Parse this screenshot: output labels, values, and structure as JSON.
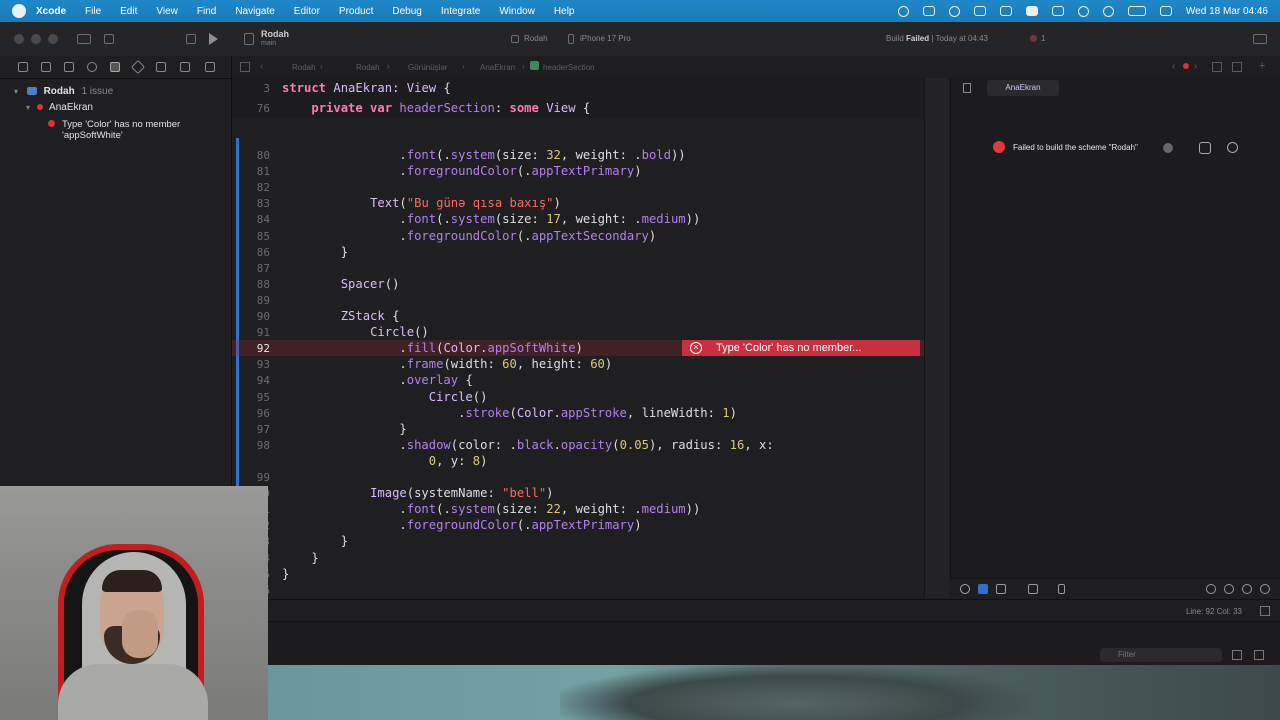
{
  "menubar": {
    "app": "Xcode",
    "items": [
      "File",
      "Edit",
      "View",
      "Find",
      "Navigate",
      "Editor",
      "Product",
      "Debug",
      "Integrate",
      "Window",
      "Help"
    ],
    "datetime": "Wed 18 Mar  04:46"
  },
  "toolbar": {
    "project": "Rodah",
    "branch": "main",
    "scheme": "Rodah",
    "device": "iPhone 17 Pro",
    "status_prefix": "Build ",
    "status_failed": "Failed",
    "status_suffix": " | Today at 04:43",
    "issue_count": "1"
  },
  "navigator": {
    "project": "Rodah",
    "project_issues": "1 issue",
    "file": "AnaEkran",
    "issue_line1": "Type 'Color' has no member",
    "issue_line2": "'appSoftWhite'"
  },
  "editor": {
    "breadcrumb": [
      "Rodah",
      "Rodah",
      "Görünüşlər",
      "AnaEkran",
      "headerSection"
    ],
    "sticky": [
      {
        "ln": "3",
        "code": "struct AnaEkran: View {"
      },
      {
        "ln": "76",
        "code": "    private var headerSection: some View {"
      }
    ],
    "lines": [
      {
        "ln": "80",
        "code": "                .font(.system(size: 32, weight: .bold))"
      },
      {
        "ln": "81",
        "code": "                .foregroundColor(.appTextPrimary)"
      },
      {
        "ln": "82",
        "code": ""
      },
      {
        "ln": "83",
        "code": "            Text(\"Bu günə qısa baxış\")"
      },
      {
        "ln": "84",
        "code": "                .font(.system(size: 17, weight: .medium))"
      },
      {
        "ln": "85",
        "code": "                .foregroundColor(.appTextSecondary)"
      },
      {
        "ln": "86",
        "code": "        }"
      },
      {
        "ln": "87",
        "code": ""
      },
      {
        "ln": "88",
        "code": "        Spacer()"
      },
      {
        "ln": "89",
        "code": ""
      },
      {
        "ln": "90",
        "code": "        ZStack {"
      },
      {
        "ln": "91",
        "code": "            Circle()"
      },
      {
        "ln": "92",
        "code": "                .fill(Color.appSoftWhite)"
      },
      {
        "ln": "93",
        "code": "                .frame(width: 60, height: 60)"
      },
      {
        "ln": "94",
        "code": "                .overlay {"
      },
      {
        "ln": "95",
        "code": "                    Circle()"
      },
      {
        "ln": "96",
        "code": "                        .stroke(Color.appStroke, lineWidth: 1)"
      },
      {
        "ln": "97",
        "code": "                }"
      },
      {
        "ln": "98",
        "code": "                .shadow(color: .black.opacity(0.05), radius: 16, x:"
      },
      {
        "ln": "",
        "code": "                    0, y: 8)"
      },
      {
        "ln": "99",
        "code": ""
      },
      {
        "ln": "100",
        "code": "            Image(systemName: \"bell\")"
      },
      {
        "ln": "101",
        "code": "                .font(.system(size: 22, weight: .medium))"
      },
      {
        "ln": "102",
        "code": "                .foregroundColor(.appTextPrimary)"
      },
      {
        "ln": "103",
        "code": "        }"
      },
      {
        "ln": "104",
        "code": "    }"
      },
      {
        "ln": "105",
        "code": "}"
      },
      {
        "ln": "106",
        "code": ""
      }
    ],
    "error_bubble": "Type 'Color' has no member..."
  },
  "canvas": {
    "tab": "AnaEkran",
    "message": "Failed to build the scheme \"Rodah\""
  },
  "statusbar": {
    "position": "Line: 92  Col: 33"
  },
  "debug": {
    "filter_placeholder": "Filter"
  },
  "colors": {
    "menubar": "#1a7bb8",
    "error": "#c8303f",
    "keyword": "#ff7ab2"
  }
}
